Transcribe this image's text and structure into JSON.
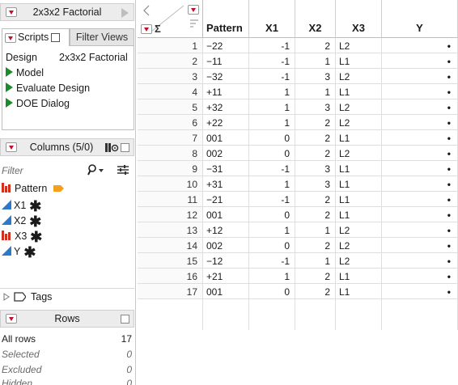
{
  "table_panel": {
    "title": "2x3x2 Factorial"
  },
  "scripts_panel": {
    "tab_scripts": "Scripts",
    "tab_filter": "Filter Views",
    "design_key": "Design",
    "design_value": "2x3x2 Factorial",
    "items": [
      "Model",
      "Evaluate Design",
      "DOE Dialog"
    ]
  },
  "columns_panel": {
    "title": "Columns (5/0)",
    "filter_placeholder": "Filter",
    "columns": [
      {
        "name": "Pattern",
        "type": "nominal",
        "tag": "label"
      },
      {
        "name": "X1",
        "type": "continuous",
        "tag": "*"
      },
      {
        "name": "X2",
        "type": "continuous",
        "tag": "*"
      },
      {
        "name": "X3",
        "type": "nominal",
        "tag": "*"
      },
      {
        "name": "Y",
        "type": "continuous",
        "tag": "*"
      }
    ]
  },
  "tags_section": {
    "label": "Tags"
  },
  "rows_panel": {
    "title": "Rows",
    "all_rows_label": "All rows",
    "all_rows_value": "17",
    "selected_label": "Selected",
    "selected_value": "0",
    "excluded_label": "Excluded",
    "excluded_value": "0",
    "hidden_label": "Hidden",
    "hidden_value": "0"
  },
  "table": {
    "headers": [
      "Pattern",
      "X1",
      "X2",
      "X3",
      "Y"
    ],
    "rows": [
      [
        "1",
        "−22",
        "-1",
        "2",
        "L2",
        "•"
      ],
      [
        "2",
        "−11",
        "-1",
        "1",
        "L1",
        "•"
      ],
      [
        "3",
        "−32",
        "-1",
        "3",
        "L2",
        "•"
      ],
      [
        "4",
        "+11",
        "1",
        "1",
        "L1",
        "•"
      ],
      [
        "5",
        "+32",
        "1",
        "3",
        "L2",
        "•"
      ],
      [
        "6",
        "+22",
        "1",
        "2",
        "L2",
        "•"
      ],
      [
        "7",
        "001",
        "0",
        "2",
        "L1",
        "•"
      ],
      [
        "8",
        "002",
        "0",
        "2",
        "L2",
        "•"
      ],
      [
        "9",
        "−31",
        "-1",
        "3",
        "L1",
        "•"
      ],
      [
        "10",
        "+31",
        "1",
        "3",
        "L1",
        "•"
      ],
      [
        "11",
        "−21",
        "-1",
        "2",
        "L1",
        "•"
      ],
      [
        "12",
        "001",
        "0",
        "2",
        "L1",
        "•"
      ],
      [
        "13",
        "+12",
        "1",
        "1",
        "L2",
        "•"
      ],
      [
        "14",
        "002",
        "0",
        "2",
        "L2",
        "•"
      ],
      [
        "15",
        "−12",
        "-1",
        "1",
        "L2",
        "•"
      ],
      [
        "16",
        "+21",
        "1",
        "2",
        "L1",
        "•"
      ],
      [
        "17",
        "001",
        "0",
        "2",
        "L1",
        "•"
      ]
    ]
  },
  "icons": {
    "nominal": "bar-chart-icon",
    "continuous": "triangle-icon",
    "label": "label-tag-icon"
  },
  "colors": {
    "red_triangle": "#c0102a",
    "run_green": "#1d8a2e",
    "continuous_blue": "#2e78c8",
    "nominal_red": "#d0311f",
    "label_orange": "#f2a01e"
  }
}
